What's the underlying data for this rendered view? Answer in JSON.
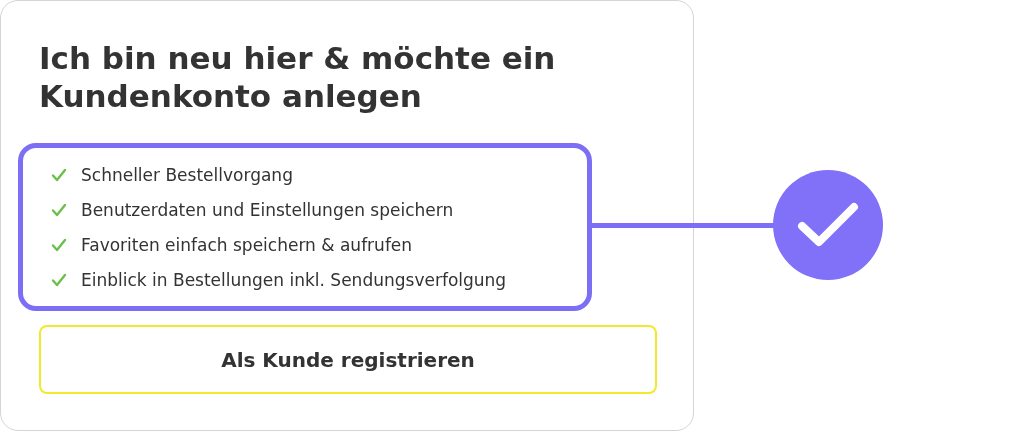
{
  "card": {
    "title": "Ich bin neu hier & möchte ein Kundenkonto anlegen",
    "benefits": [
      {
        "label": "Schneller Bestellvorgang"
      },
      {
        "label": "Benutzerdaten und Einstellungen speichern"
      },
      {
        "label": "Favoriten einfach speichern & aufrufen"
      },
      {
        "label": "Einblick in Bestellungen inkl. Sendungsverfolgung"
      }
    ],
    "button": "Als Kunde registrieren"
  }
}
